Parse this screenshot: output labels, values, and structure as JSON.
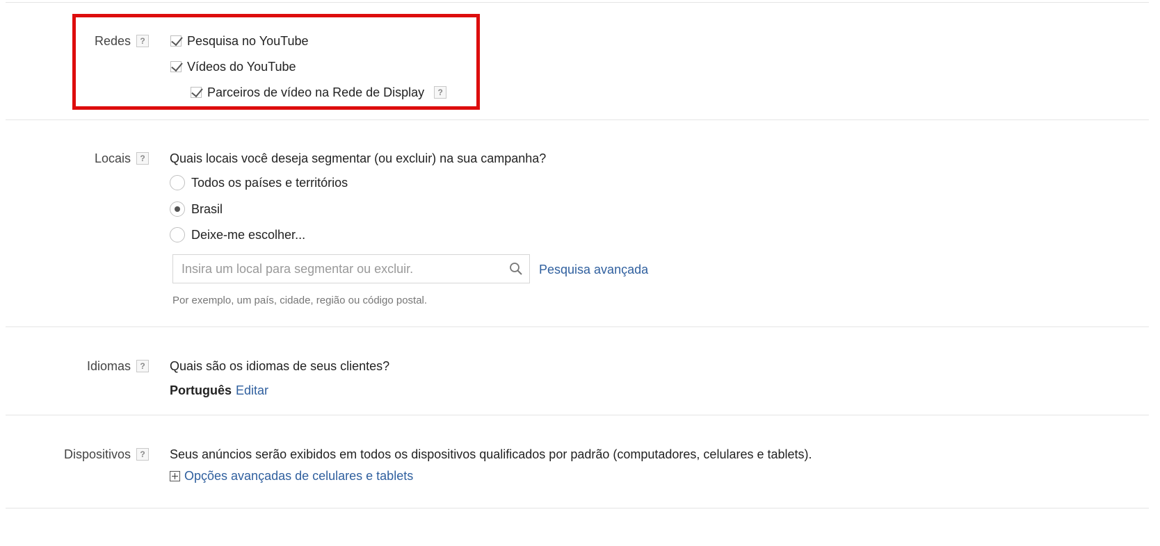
{
  "networks": {
    "label": "Redes",
    "help": "?",
    "options": [
      {
        "label": "Pesquisa no YouTube",
        "checked": true
      },
      {
        "label": "Vídeos do YouTube",
        "checked": true
      },
      {
        "label": "Parceiros de vídeo na Rede de Display",
        "checked": true
      }
    ]
  },
  "locations": {
    "label": "Locais",
    "help": "?",
    "question": "Quais locais você deseja segmentar (ou excluir) na sua campanha?",
    "options": [
      {
        "label": "Todos os países e territórios",
        "selected": false
      },
      {
        "label": "Brasil",
        "selected": true
      },
      {
        "label": "Deixe-me escolher...",
        "selected": false
      }
    ],
    "search_placeholder": "Insira um local para segmentar ou excluir.",
    "advanced_search": "Pesquisa avançada",
    "hint": "Por exemplo, um país, cidade, região ou código postal."
  },
  "languages": {
    "label": "Idiomas",
    "help": "?",
    "question": "Quais são os idiomas de seus clientes?",
    "value": "Português",
    "edit": "Editar"
  },
  "devices": {
    "label": "Dispositivos",
    "help": "?",
    "description": "Seus anúncios serão exibidos em todos os dispositivos qualificados por padrão (computadores, celulares e tablets).",
    "advanced_link": "Opções avançadas de celulares e tablets"
  },
  "colors": {
    "highlight_box": "#dd0d0d",
    "link": "#2f5f9e",
    "divider": "#e5e5e5"
  }
}
